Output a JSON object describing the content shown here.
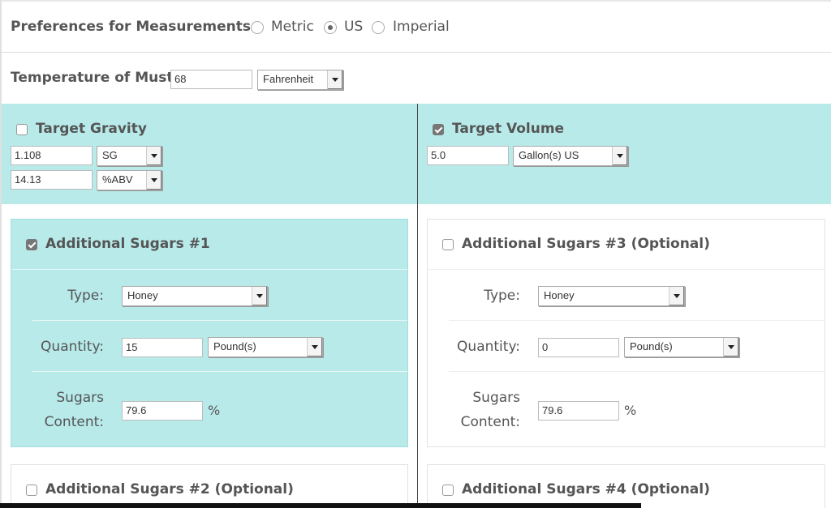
{
  "preferences": {
    "label": "Preferences for Measurements:",
    "options": [
      "Metric",
      "US",
      "Imperial"
    ],
    "selected": "US"
  },
  "temperature": {
    "label": "Temperature of Must",
    "value": "68",
    "unit": "Fahrenheit"
  },
  "target_gravity": {
    "label": "Target Gravity",
    "checked": false,
    "gravity_value": "1.108",
    "gravity_unit": "SG",
    "abv_value": "14.13",
    "abv_unit": "%ABV"
  },
  "target_volume": {
    "label": "Target Volume",
    "checked": true,
    "value": "5.0",
    "unit": "Gallon(s) US"
  },
  "field_labels": {
    "type": "Type:",
    "quantity": "Quantity:",
    "sugars_line1": "Sugars",
    "sugars_line2": "Content:",
    "percent": "%"
  },
  "sugars": [
    {
      "label": "Additional Sugars #1",
      "checked": true,
      "type": "Honey",
      "quantity": "15",
      "quantity_unit": "Pound(s)",
      "content": "79.6"
    },
    {
      "label": "Additional Sugars #3 (Optional)",
      "checked": false,
      "type": "Honey",
      "quantity": "0",
      "quantity_unit": "Pound(s)",
      "content": "79.6"
    },
    {
      "label": "Additional Sugars #2 (Optional)",
      "checked": false
    },
    {
      "label": "Additional Sugars #4 (Optional)",
      "checked": false
    }
  ],
  "colors": {
    "active_panel": "#b8eaea",
    "text": "#555555"
  }
}
